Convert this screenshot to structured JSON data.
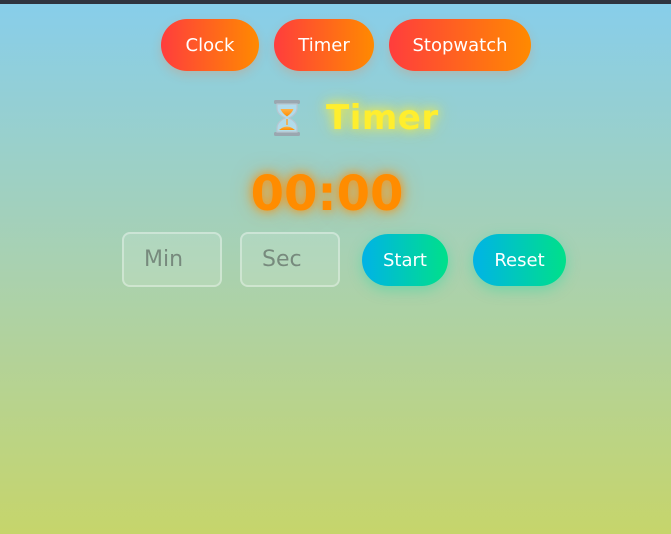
{
  "nav": {
    "tabs": [
      {
        "label": "Clock"
      },
      {
        "label": "Timer"
      },
      {
        "label": "Stopwatch"
      }
    ]
  },
  "timer": {
    "icon": "hourglass-icon",
    "title": "Timer",
    "display": "00:00",
    "minutes_placeholder": "Min",
    "seconds_placeholder": "Sec",
    "minutes_value": "",
    "seconds_value": "",
    "start_label": "Start",
    "reset_label": "Reset"
  },
  "colors": {
    "tab_gradient_start": "#ff3d3d",
    "tab_gradient_end": "#ff8a00",
    "action_gradient_start": "#00b3e6",
    "action_gradient_end": "#00e08a",
    "title_color": "#ffee2e",
    "display_color": "#ff8c00",
    "background_top": "#87ceeb",
    "background_bottom": "#c6d56b"
  }
}
